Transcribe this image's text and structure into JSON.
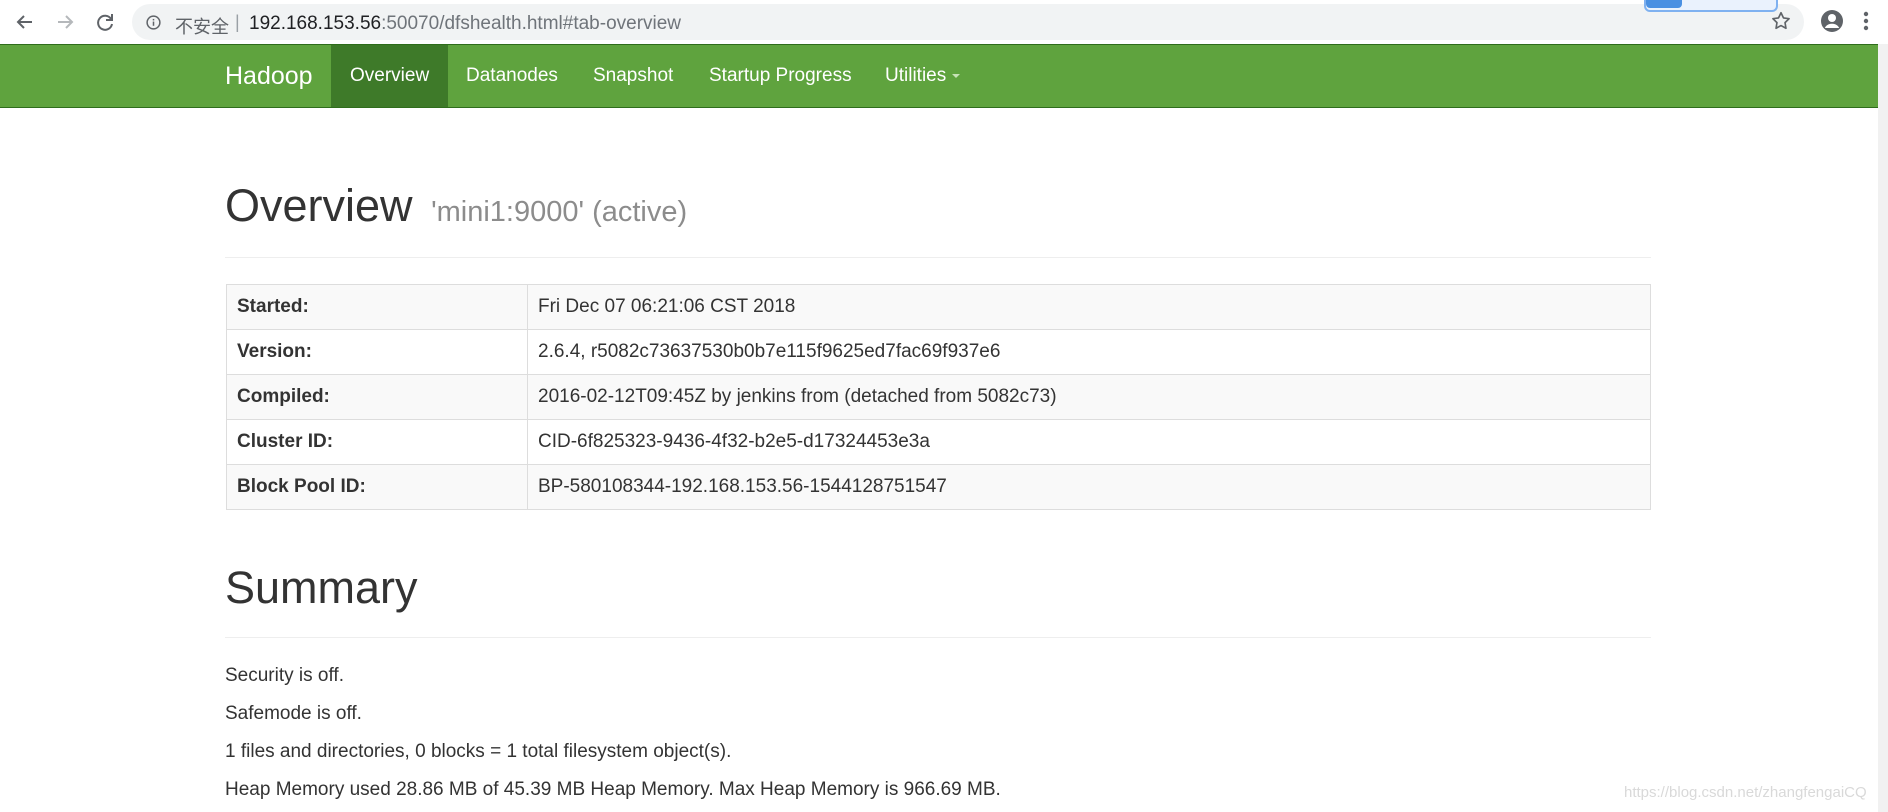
{
  "browser": {
    "insecure_label": "不安全",
    "separator": "|",
    "url_host": "192.168.153.56",
    "url_rest": ":50070/dfshealth.html#tab-overview",
    "icons": [
      "back-arrow-icon",
      "forward-arrow-icon",
      "reload-icon",
      "info-icon",
      "star-icon",
      "account-icon",
      "menu-icon"
    ]
  },
  "navbar": {
    "brand": "Hadoop",
    "items": [
      {
        "label": "Overview",
        "active": true
      },
      {
        "label": "Datanodes",
        "active": false
      },
      {
        "label": "Snapshot",
        "active": false
      },
      {
        "label": "Startup Progress",
        "active": false
      },
      {
        "label": "Utilities",
        "active": false
      }
    ],
    "color": "#5fa33e",
    "active_color": "#3e7a29"
  },
  "overview": {
    "title": "Overview",
    "subtitle": "'mini1:9000' (active)",
    "rows": [
      {
        "label": "Started:",
        "value": "Fri Dec 07 06:21:06 CST 2018"
      },
      {
        "label": "Version:",
        "value": "2.6.4, r5082c73637530b0b7e115f9625ed7fac69f937e6"
      },
      {
        "label": "Compiled:",
        "value": "2016-02-12T09:45Z by jenkins from (detached from 5082c73)"
      },
      {
        "label": "Cluster ID:",
        "value": "CID-6f825323-9436-4f32-b2e5-d17324453e3a"
      },
      {
        "label": "Block Pool ID:",
        "value": "BP-580108344-192.168.153.56-1544128751547"
      }
    ]
  },
  "summary": {
    "title": "Summary",
    "lines": [
      "Security is off.",
      "Safemode is off.",
      "1 files and directories, 0 blocks = 1 total filesystem object(s).",
      "Heap Memory used 28.86 MB of 45.39 MB Heap Memory. Max Heap Memory is 966.69 MB."
    ]
  },
  "watermark": "https://blog.csdn.net/zhangfengaiCQ"
}
